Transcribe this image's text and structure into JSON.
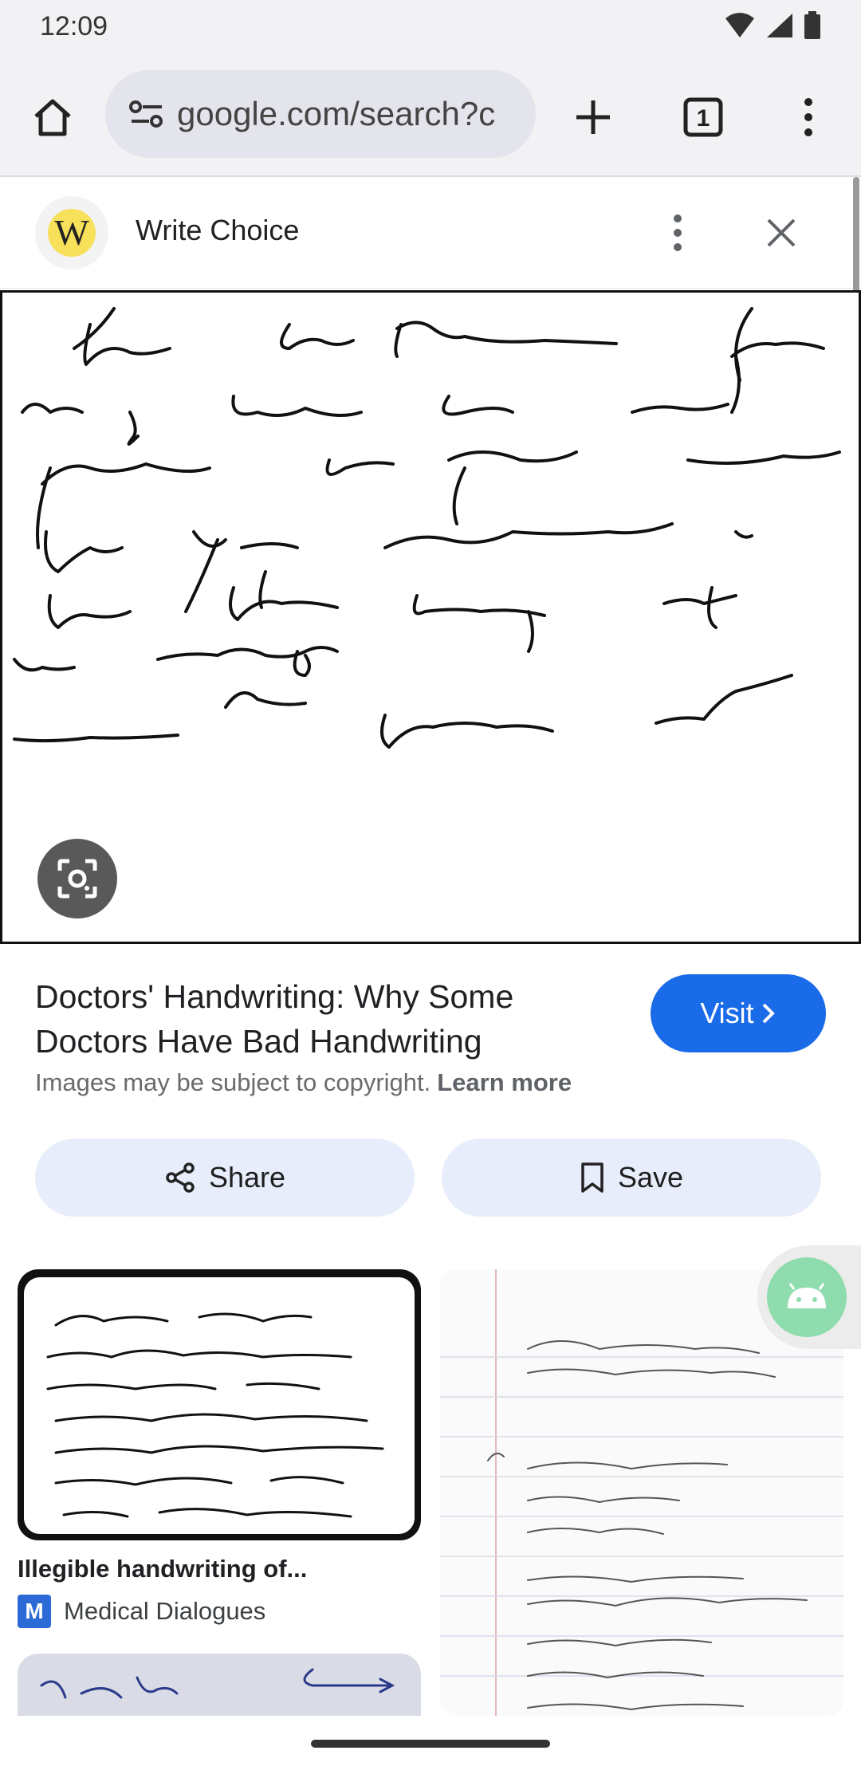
{
  "status": {
    "time": "12:09",
    "icons": [
      "wifi-icon",
      "signal-icon",
      "battery-icon"
    ]
  },
  "toolbar": {
    "url": "google.com/search?c",
    "tab_count": "1"
  },
  "source": {
    "logo_letter": "W",
    "title": "Write Choice"
  },
  "result": {
    "title": "Doctors' Handwriting: Why Some Doctors Have Bad Handwriting",
    "visit_label": "Visit",
    "copyright_text": "Images may be subject to copyright.",
    "learn_more": "Learn more",
    "share_label": "Share",
    "save_label": "Save"
  },
  "related": [
    {
      "caption": "Illegible handwriting of...",
      "source": "Medical Dialogues",
      "source_logo": "M"
    }
  ],
  "colors": {
    "accent": "#1a6be8",
    "pill_bg": "#e7edfb",
    "toolbar_bg": "#f2f2f5"
  }
}
